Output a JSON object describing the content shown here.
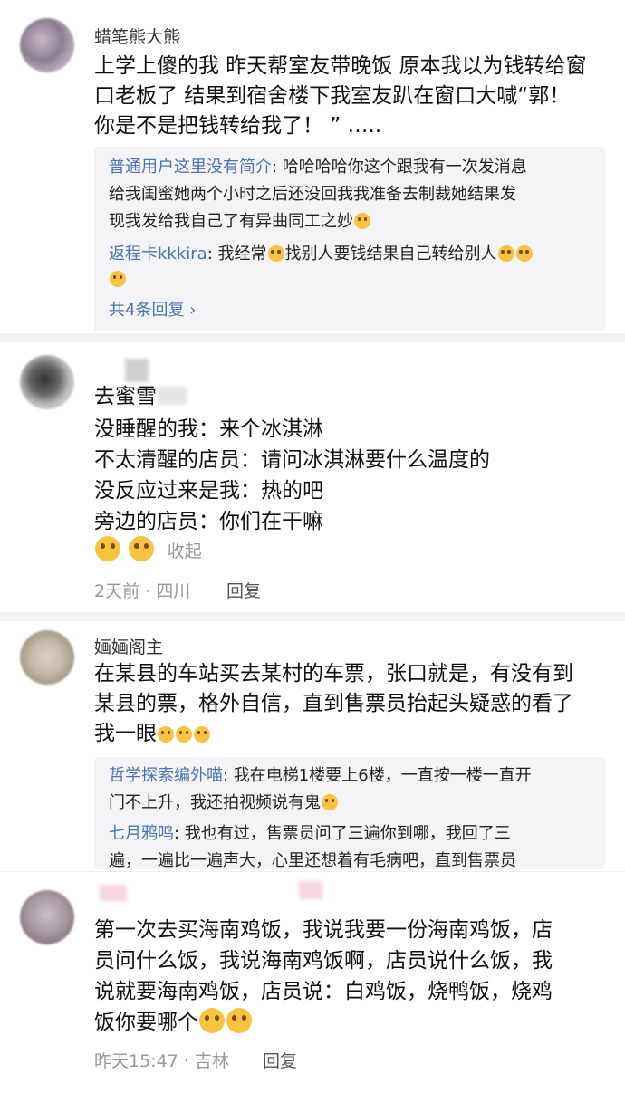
{
  "comments": [
    {
      "username": "蜡笔熊大熊",
      "lines": [
        "上学上傻的我 昨天帮室友带晚饭 原本我以为钱转给窗",
        "口老板了 结果到宿舍楼下我室友趴在窗口大喊“郭！",
        "你是不是把钱转给我了！ ” ….."
      ],
      "replies": [
        {
          "user": "普通用户这里没有简介",
          "lines": [
            "哈哈哈哈你这个跟我有一次发消息",
            "给我闺蜜她两个小时之后还没回我我准备去制裁她结果发",
            "现我发给我自己了有异曲同工之妙"
          ]
        },
        {
          "user": "返程卡kkkira",
          "segments": [
            "我经常",
            "找别人要钱结果自己转给别人"
          ]
        }
      ],
      "more_replies": "共4条回复 ›",
      "emoji_names": [
        "cry-laugh-emoji",
        "sweat-smile-emoji"
      ]
    },
    {
      "lines": [
        "去蜜雪",
        "没睡醒的我：来个冰淇淋",
        "不太清醒的店员：请问冰淇淋要什么温度的",
        "没反应过来是我：热的吧",
        "旁边的店员：你们在干嘛"
      ],
      "collapse": "收起",
      "meta": "2天前 · 四川",
      "reply": "回复",
      "emoji_names": [
        "big-laugh-emoji"
      ]
    },
    {
      "username": "婳婳阁主",
      "lines": [
        "在某县的车站买去某村的车票，张口就是，有没有到",
        "某县的票，格外自信，直到售票员抬起头疑惑的看了",
        "我一眼"
      ],
      "replies": [
        {
          "user": "哲学探索编外喵",
          "lines": [
            "我在电梯1楼要上6楼，一直按一楼一直开",
            "门不上升，我还拍视频说有鬼"
          ]
        },
        {
          "user": "七月鸦鸣",
          "lines": [
            "我也有过，售票员问了三遍你到哪，我回了三",
            "遍，一遍比一遍声大，心里还想着有毛病吧，直到售票员"
          ]
        }
      ],
      "emoji_names": [
        "rolling-eyes-emoji",
        "cry-emoji"
      ]
    },
    {
      "lines": [
        "第一次去买海南鸡饭，我说我要一份海南鸡饭，店",
        "员问什么饭，我说海南鸡饭啊，店员说什么饭，我",
        "说就要海南鸡饭，店员说：白鸡饭，烧鸭饭，烧鸡",
        "饭你要哪个"
      ],
      "meta": "昨天15:47 · 吉林",
      "reply": "回复",
      "emoji_names": [
        "cry-emoji"
      ]
    }
  ],
  "colors": {
    "link_blue": "#4a74b0",
    "reply_bg": "#f4f4f6",
    "meta_gray": "#999999",
    "separator": "#f1f1f1",
    "emoji_yellow": "#f7c442"
  }
}
